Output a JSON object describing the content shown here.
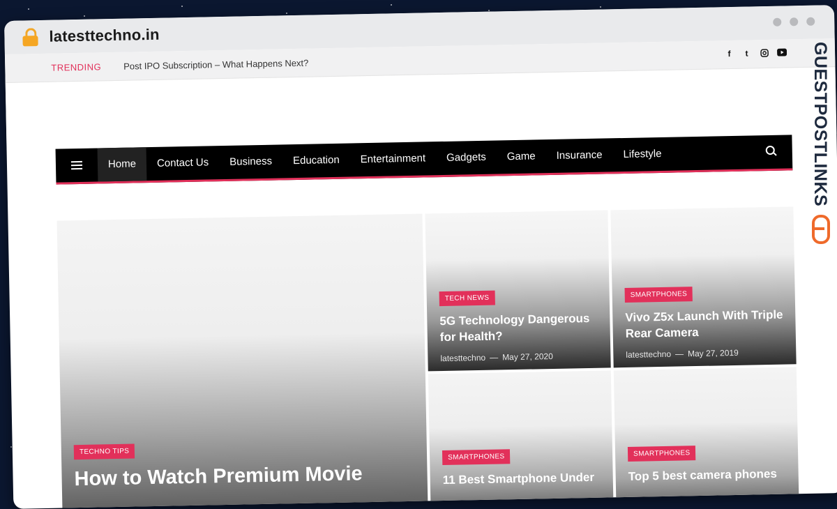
{
  "browser": {
    "domain": "latesttechno.in"
  },
  "topbar": {
    "trending_label": "TRENDING",
    "trending_headline": "Post IPO Subscription – What Happens Next?",
    "social_icons": [
      "facebook-icon",
      "twitter-icon",
      "instagram-icon",
      "youtube-icon"
    ]
  },
  "nav": {
    "items": [
      {
        "label": "Home",
        "active": true
      },
      {
        "label": "Contact Us"
      },
      {
        "label": "Business"
      },
      {
        "label": "Education"
      },
      {
        "label": "Entertainment"
      },
      {
        "label": "Gadgets"
      },
      {
        "label": "Game"
      },
      {
        "label": "Insurance"
      },
      {
        "label": "Lifestyle"
      }
    ]
  },
  "featured": {
    "main": {
      "category": "TECHNO TIPS",
      "title": "How to Watch Premium Movie"
    },
    "cards": [
      {
        "category": "TECH NEWS",
        "title": "5G Technology Dangerous for Health?",
        "author": "latesttechno",
        "sep": "—",
        "date": "May 27, 2020"
      },
      {
        "category": "SMARTPHONES",
        "title": "Vivo Z5x Launch With Triple Rear Camera",
        "author": "latesttechno",
        "sep": "—",
        "date": "May 27, 2019"
      },
      {
        "category": "SMARTPHONES",
        "title": "11 Best Smartphone Under"
      },
      {
        "category": "SMARTPHONES",
        "title": "Top 5 best camera phones"
      }
    ]
  },
  "watermark": {
    "brand": "GUESTPOSTLINKS"
  },
  "colors": {
    "accent": "#e2305a",
    "nav_bg": "#000000",
    "brand_orange": "#ef6a2b",
    "brand_navy": "#1e2a3e"
  }
}
